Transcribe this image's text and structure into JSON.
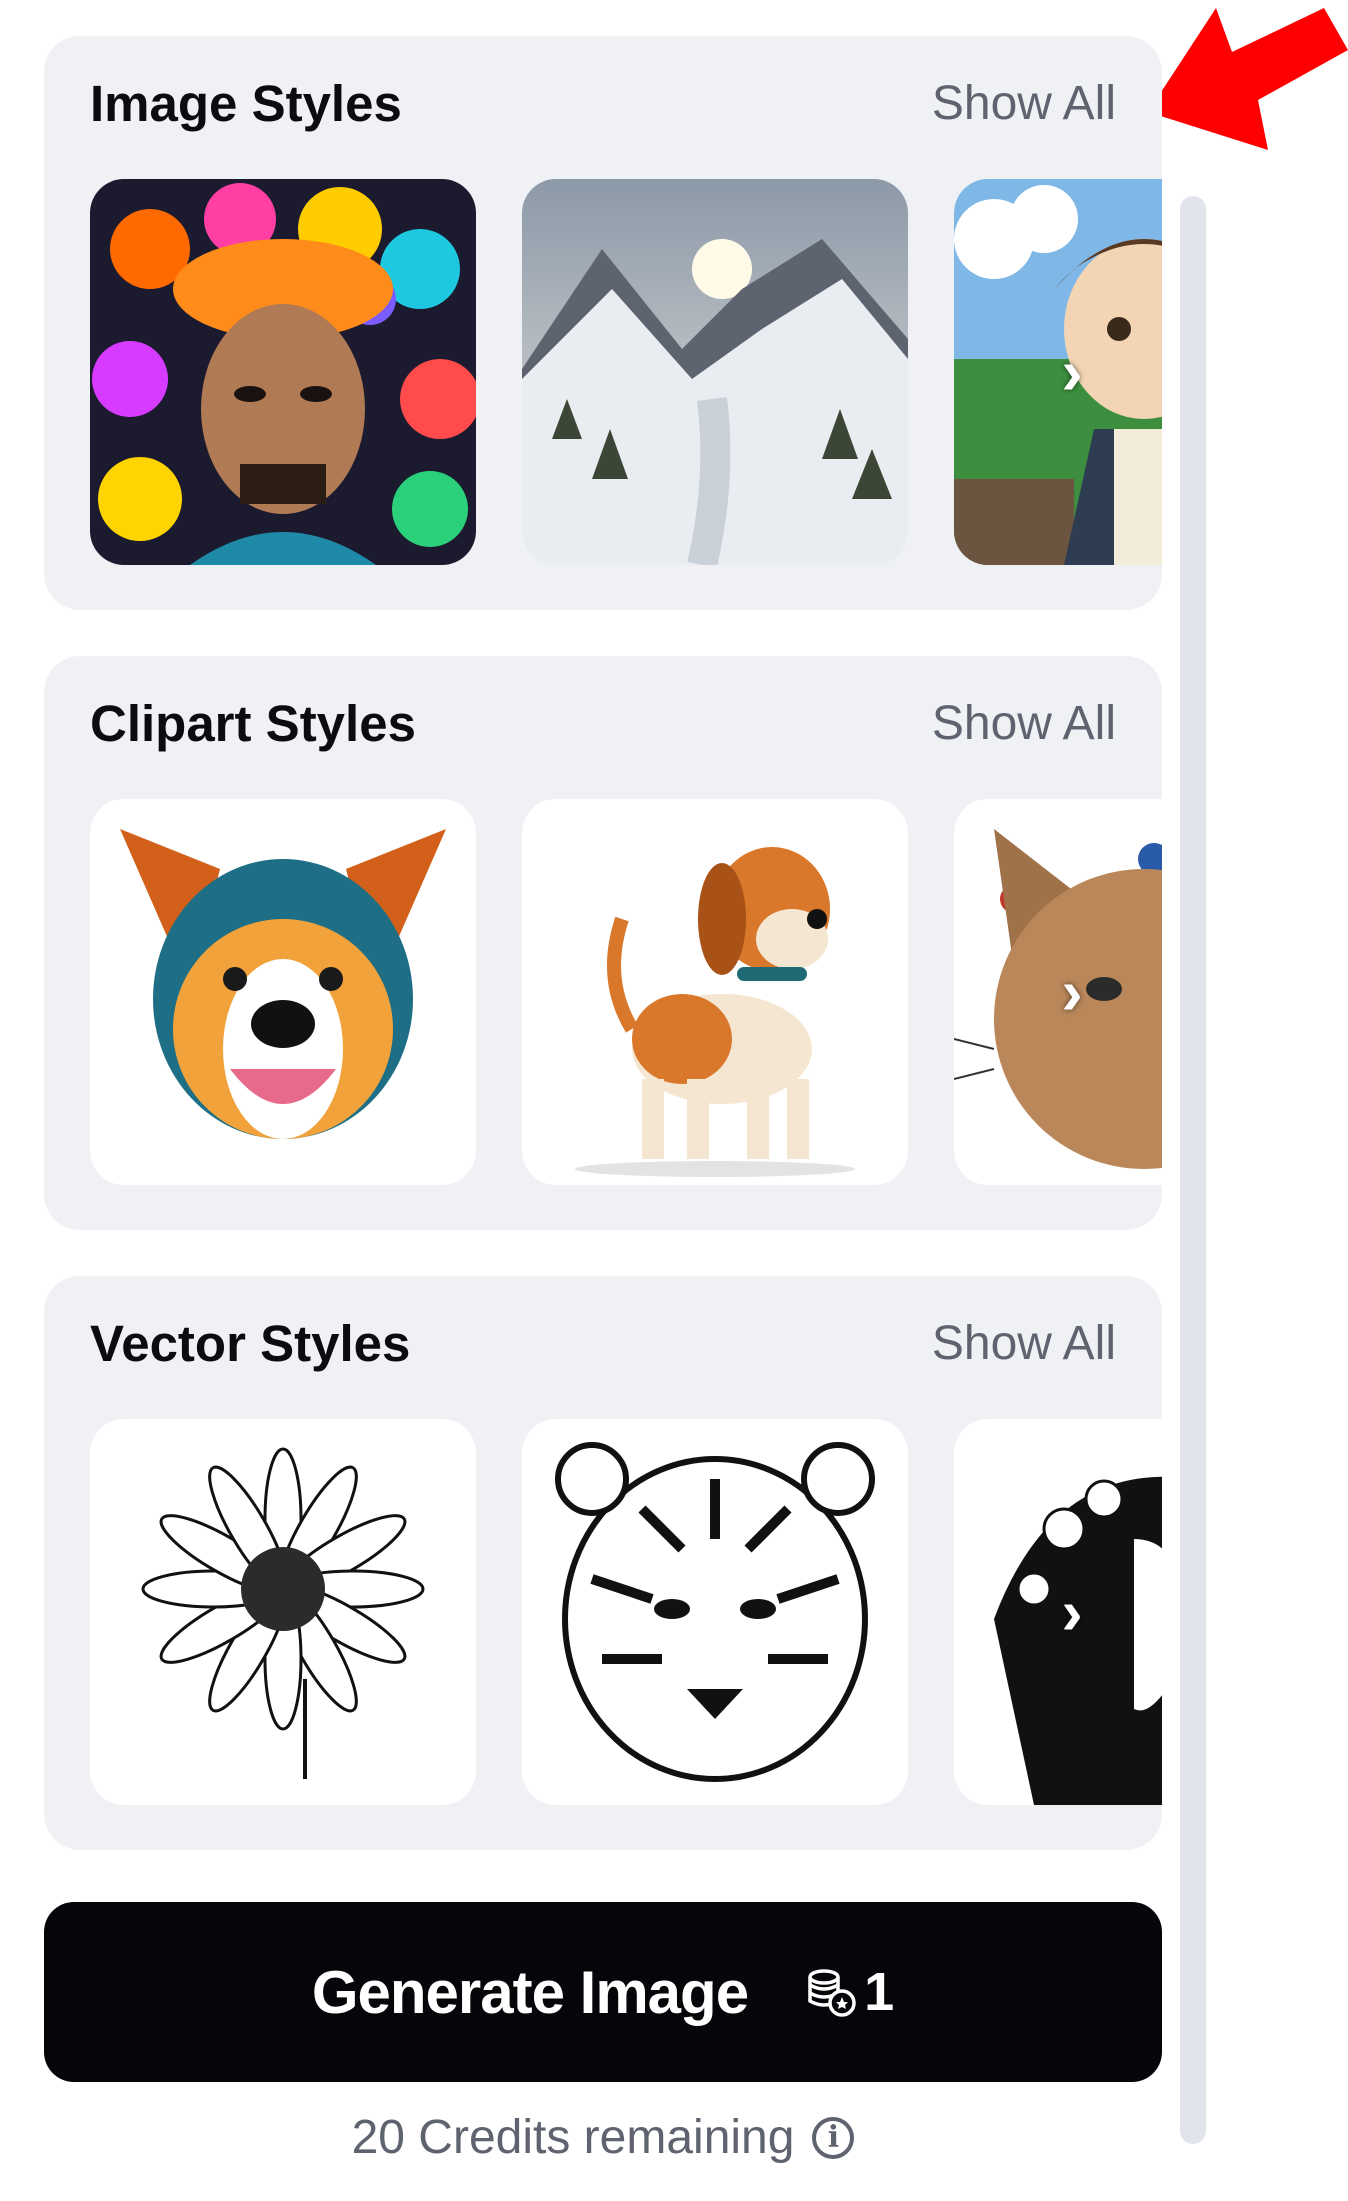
{
  "sections": [
    {
      "title": "Image Styles",
      "show_all": "Show All",
      "cards": [
        "portrait-with-flowers-and-birds",
        "snowy-mountain-valley",
        "anime-boy"
      ]
    },
    {
      "title": "Clipart Styles",
      "show_all": "Show All",
      "cards": [
        "colorful-dog-head",
        "cartoon-beagle",
        "watercolor-cat"
      ]
    },
    {
      "title": "Vector Styles",
      "show_all": "Show All",
      "cards": [
        "line-art-daisy",
        "ink-tiger-face",
        "floral-portrait-silhouette"
      ]
    }
  ],
  "generate": {
    "label": "Generate Image",
    "cost": "1",
    "icon": "coins-icon"
  },
  "credits": {
    "text": "20 Credits remaining",
    "icon": "info-icon"
  },
  "annotation": {
    "icon": "red-arrow",
    "color": "#ff0000"
  },
  "colors": {
    "panel_bg": "#f0f1f5",
    "button_bg": "#05060a",
    "muted_text": "#5f6370"
  }
}
